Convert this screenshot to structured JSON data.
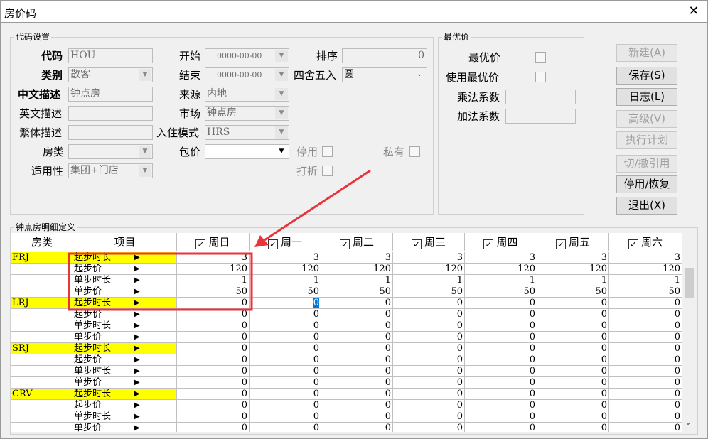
{
  "window": {
    "title": "房价码",
    "close_glyph": "✕"
  },
  "code_group": {
    "title": "代码设置",
    "labels": {
      "code": "代码",
      "type": "类别",
      "cn_desc": "中文描述",
      "en_desc": "英文描述",
      "tr_desc": "繁体描述",
      "room_type": "房类",
      "applicability": "适用性",
      "start": "开始",
      "end": "结束",
      "source": "来源",
      "market": "市场",
      "checkin_mode": "入住模式",
      "package": "包价",
      "sort": "排序",
      "rounding": "四舍五入",
      "disable": "停用",
      "discount": "打折",
      "private": "私有"
    },
    "values": {
      "code": "HOU",
      "type": "散客",
      "cn_desc": "钟点房",
      "en_desc": "",
      "tr_desc": "",
      "room_type": "",
      "applicability": "集团+门店",
      "start": "0000-00-00",
      "end": "0000-00-00",
      "source": "内地",
      "market": "钟点房",
      "checkin_mode": "HRS",
      "package": "",
      "sort": "0",
      "rounding": "圆"
    }
  },
  "best_group": {
    "title": "最优价",
    "labels": {
      "best": "最优价",
      "use_best": "使用最优价",
      "mult": "乘法系数",
      "add": "加法系数"
    },
    "values": {
      "mult": "",
      "add": ""
    }
  },
  "buttons": {
    "new": "新建(A)",
    "save": "保存(S)",
    "log": "日志(L)",
    "advanced": "高级(V)",
    "exec_plan": "执行计划",
    "switch_ref": "切/撤引用",
    "toggle": "停用/恢复",
    "exit": "退出(X)"
  },
  "detail": {
    "title": "钟点房明细定义",
    "headers": {
      "room_type": "房类",
      "item": "项目",
      "days": [
        "周日",
        "周一",
        "周二",
        "周三",
        "周四",
        "周五",
        "周六"
      ]
    },
    "rows": [
      {
        "type": "FRJ",
        "item": "起步时长",
        "vals": [
          "3",
          "3",
          "3",
          "3",
          "3",
          "3",
          "3"
        ]
      },
      {
        "type": "",
        "item": "起步价",
        "vals": [
          "120",
          "120",
          "120",
          "120",
          "120",
          "120",
          "120"
        ]
      },
      {
        "type": "",
        "item": "单步时长",
        "vals": [
          "1",
          "1",
          "1",
          "1",
          "1",
          "1",
          "1"
        ]
      },
      {
        "type": "",
        "item": "单步价",
        "vals": [
          "50",
          "50",
          "50",
          "50",
          "50",
          "50",
          "50"
        ]
      },
      {
        "type": "LRJ",
        "item": "起步时长",
        "vals": [
          "0",
          "0",
          "0",
          "0",
          "0",
          "0",
          "0"
        ]
      },
      {
        "type": "",
        "item": "起步价",
        "vals": [
          "0",
          "0",
          "0",
          "0",
          "0",
          "0",
          "0"
        ]
      },
      {
        "type": "",
        "item": "单步时长",
        "vals": [
          "0",
          "0",
          "0",
          "0",
          "0",
          "0",
          "0"
        ]
      },
      {
        "type": "",
        "item": "单步价",
        "vals": [
          "0",
          "0",
          "0",
          "0",
          "0",
          "0",
          "0"
        ]
      },
      {
        "type": "SRJ",
        "item": "起步时长",
        "vals": [
          "0",
          "0",
          "0",
          "0",
          "0",
          "0",
          "0"
        ]
      },
      {
        "type": "",
        "item": "起步价",
        "vals": [
          "0",
          "0",
          "0",
          "0",
          "0",
          "0",
          "0"
        ]
      },
      {
        "type": "",
        "item": "单步时长",
        "vals": [
          "0",
          "0",
          "0",
          "0",
          "0",
          "0",
          "0"
        ]
      },
      {
        "type": "",
        "item": "单步价",
        "vals": [
          "0",
          "0",
          "0",
          "0",
          "0",
          "0",
          "0"
        ]
      },
      {
        "type": "CRV",
        "item": "起步时长",
        "vals": [
          "0",
          "0",
          "0",
          "0",
          "0",
          "0",
          "0"
        ]
      },
      {
        "type": "",
        "item": "起步价",
        "vals": [
          "0",
          "0",
          "0",
          "0",
          "0",
          "0",
          "0"
        ]
      },
      {
        "type": "",
        "item": "单步时长",
        "vals": [
          "0",
          "0",
          "0",
          "0",
          "0",
          "0",
          "0"
        ]
      },
      {
        "type": "",
        "item": "单步价",
        "vals": [
          "0",
          "0",
          "0",
          "0",
          "0",
          "0",
          "0"
        ]
      }
    ]
  },
  "colors": {
    "highlight_yellow": "#ffff00",
    "annotation_red": "#e8343a",
    "selection_blue": "#0078d7"
  }
}
